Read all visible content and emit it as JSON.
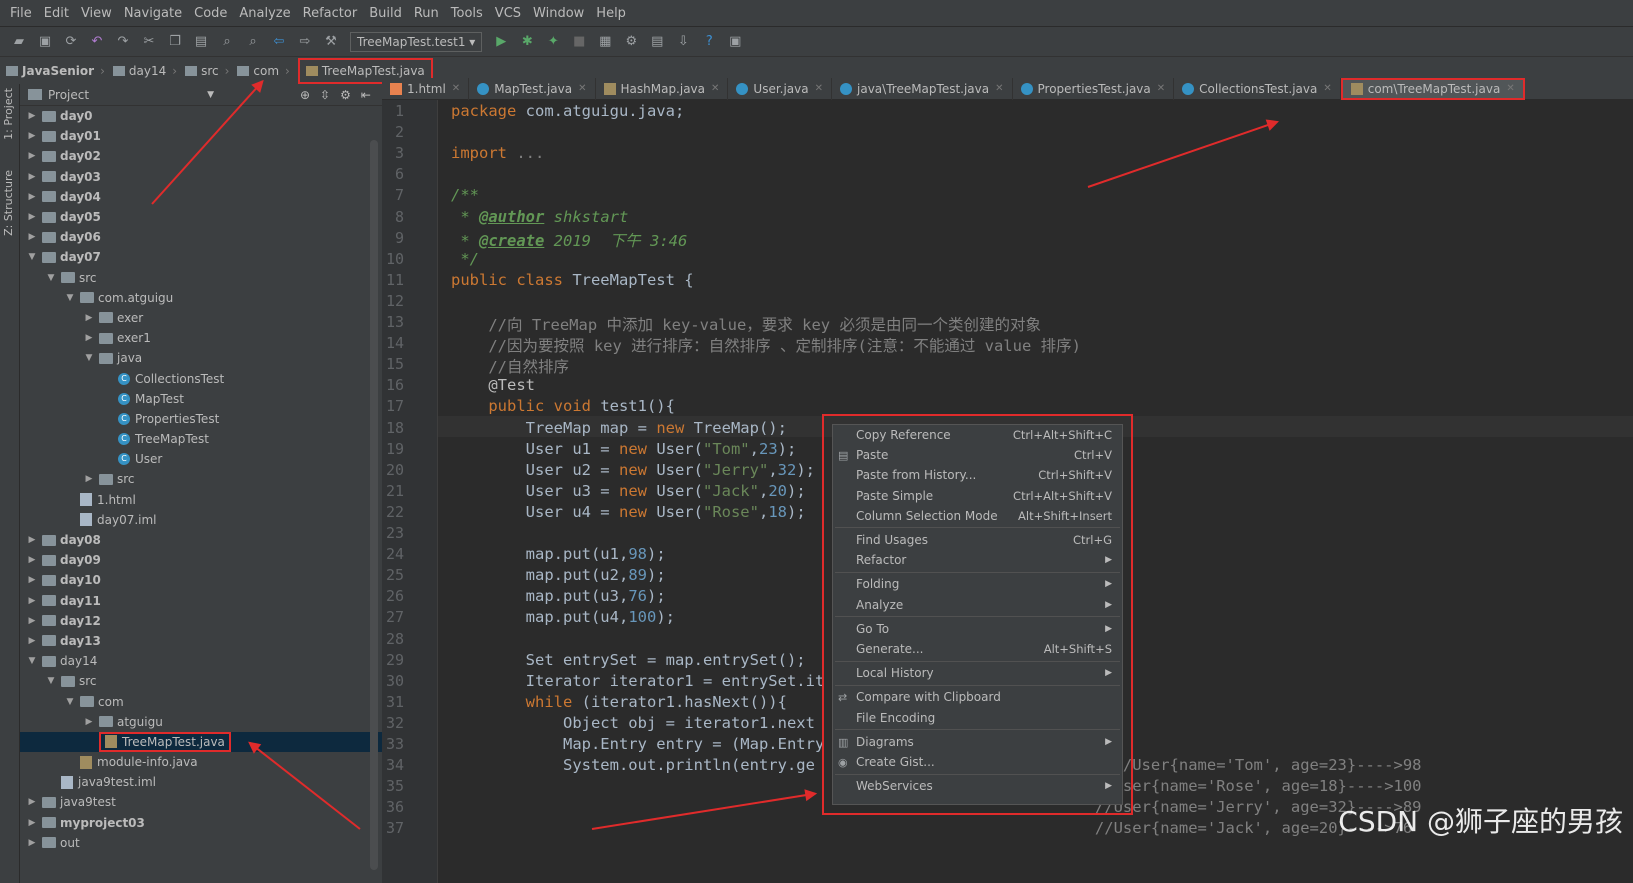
{
  "menu": [
    "File",
    "Edit",
    "View",
    "Navigate",
    "Code",
    "Analyze",
    "Refactor",
    "Build",
    "Run",
    "Tools",
    "VCS",
    "Window",
    "Help"
  ],
  "toolbar": {
    "run_config": "TreeMapTest.test1"
  },
  "breadcrumb": [
    "JavaSenior",
    "day14",
    "src",
    "com",
    "TreeMapTest.java"
  ],
  "side_tabs": {
    "project": "1: Project",
    "structure": "Z: Structure"
  },
  "project_panel": {
    "title": "Project"
  },
  "tree": [
    {
      "label": "day0",
      "indent": 1,
      "arrow": "▶",
      "icon": "folder",
      "bold": true
    },
    {
      "label": "day01",
      "indent": 1,
      "arrow": "▶",
      "icon": "folder",
      "bold": true
    },
    {
      "label": "day02",
      "indent": 1,
      "arrow": "▶",
      "icon": "folder",
      "bold": true
    },
    {
      "label": "day03",
      "indent": 1,
      "arrow": "▶",
      "icon": "folder",
      "bold": true
    },
    {
      "label": "day04",
      "indent": 1,
      "arrow": "▶",
      "icon": "folder",
      "bold": true
    },
    {
      "label": "day05",
      "indent": 1,
      "arrow": "▶",
      "icon": "folder",
      "bold": true
    },
    {
      "label": "day06",
      "indent": 1,
      "arrow": "▶",
      "icon": "folder",
      "bold": true
    },
    {
      "label": "day07",
      "indent": 1,
      "arrow": "▼",
      "icon": "folder",
      "bold": true
    },
    {
      "label": "src",
      "indent": 2,
      "arrow": "▼",
      "icon": "folder"
    },
    {
      "label": "com.atguigu",
      "indent": 3,
      "arrow": "▼",
      "icon": "folder"
    },
    {
      "label": "exer",
      "indent": 4,
      "arrow": "▶",
      "icon": "folder"
    },
    {
      "label": "exer1",
      "indent": 4,
      "arrow": "▶",
      "icon": "folder"
    },
    {
      "label": "java",
      "indent": 4,
      "arrow": "▼",
      "icon": "folder"
    },
    {
      "label": "CollectionsTest",
      "indent": 5,
      "arrow": "",
      "icon": "class"
    },
    {
      "label": "MapTest",
      "indent": 5,
      "arrow": "",
      "icon": "class"
    },
    {
      "label": "PropertiesTest",
      "indent": 5,
      "arrow": "",
      "icon": "class"
    },
    {
      "label": "TreeMapTest",
      "indent": 5,
      "arrow": "",
      "icon": "class"
    },
    {
      "label": "User",
      "indent": 5,
      "arrow": "",
      "icon": "class"
    },
    {
      "label": "src",
      "indent": 4,
      "arrow": "▶",
      "icon": "folder"
    },
    {
      "label": "1.html",
      "indent": 3,
      "arrow": "",
      "icon": "html"
    },
    {
      "label": "day07.iml",
      "indent": 3,
      "arrow": "",
      "icon": "file"
    },
    {
      "label": "day08",
      "indent": 1,
      "arrow": "▶",
      "icon": "folder",
      "bold": true
    },
    {
      "label": "day09",
      "indent": 1,
      "arrow": "▶",
      "icon": "folder",
      "bold": true
    },
    {
      "label": "day10",
      "indent": 1,
      "arrow": "▶",
      "icon": "folder",
      "bold": true
    },
    {
      "label": "day11",
      "indent": 1,
      "arrow": "▶",
      "icon": "folder",
      "bold": true
    },
    {
      "label": "day12",
      "indent": 1,
      "arrow": "▶",
      "icon": "folder",
      "bold": true
    },
    {
      "label": "day13",
      "indent": 1,
      "arrow": "▶",
      "icon": "folder",
      "bold": true
    },
    {
      "label": "day14",
      "indent": 1,
      "arrow": "▼",
      "icon": "folder"
    },
    {
      "label": "src",
      "indent": 2,
      "arrow": "▼",
      "icon": "folder"
    },
    {
      "label": "com",
      "indent": 3,
      "arrow": "▼",
      "icon": "folder"
    },
    {
      "label": "atguigu",
      "indent": 4,
      "arrow": "▶",
      "icon": "folder"
    },
    {
      "label": "TreeMapTest.java",
      "indent": 4,
      "arrow": "",
      "icon": "java",
      "selected": true
    },
    {
      "label": "module-info.java",
      "indent": 3,
      "arrow": "",
      "icon": "java"
    },
    {
      "label": "java9test.iml",
      "indent": 2,
      "arrow": "",
      "icon": "file"
    },
    {
      "label": "java9test",
      "indent": 1,
      "arrow": "▶",
      "icon": "folder"
    },
    {
      "label": "myproject03",
      "indent": 1,
      "arrow": "▶",
      "icon": "folder",
      "bold": true
    },
    {
      "label": "out",
      "indent": 1,
      "arrow": "▶",
      "icon": "folder"
    }
  ],
  "tabs": [
    {
      "label": "1.html"
    },
    {
      "label": "MapTest.java"
    },
    {
      "label": "HashMap.java"
    },
    {
      "label": "User.java"
    },
    {
      "label": "java\\TreeMapTest.java"
    },
    {
      "label": "PropertiesTest.java"
    },
    {
      "label": "CollectionsTest.java"
    },
    {
      "label": "com\\TreeMapTest.java",
      "active": true
    }
  ],
  "line_numbers": [
    "1",
    "2",
    "3",
    "6",
    "7",
    "8",
    "9",
    "10",
    "11",
    "12",
    "13",
    "14",
    "15",
    "16",
    "17",
    "18",
    "19",
    "20",
    "21",
    "22",
    "23",
    "24",
    "25",
    "26",
    "27",
    "28",
    "29",
    "30",
    "31",
    "32",
    "33",
    "34",
    "35",
    "36",
    "37"
  ],
  "code_lines": [
    "<span class='kw'>package</span> com.atguigu.java;",
    "",
    "<span class='kw'>import</span> <span class='lc'>...</span>",
    "",
    "<span class='cm'>/**</span>",
    "<span class='cm'> * </span><span class='tag'>@author</span><span class='cm'> shkstart</span>",
    "<span class='cm'> * </span><span class='tag'>@create</span><span class='cm'> 2019  下午 3:46</span>",
    "<span class='cm'> */</span>",
    "<span class='kw'>public class</span> TreeMapTest {",
    "",
    "    <span class='lc'>//向 TreeMap 中添加 key-value，要求 key 必须是由同一个类创建的对象</span>",
    "    <span class='lc'>//因为要按照 key 进行排序：自然排序 、定制排序(注意：不能通过 value 排序)</span>",
    "    <span class='lc'>//自然排序</span>",
    "    <span class='an'>@Test</span>",
    "    <span class='kw'>public void</span> test1(){",
    "        TreeMap map = <span class='kw'>new</span> TreeMap();",
    "        User u1 = <span class='kw'>new</span> User(<span class='str'>\"Tom\"</span>,<span class='num'>23</span>);",
    "        User u2 = <span class='kw'>new</span> User(<span class='str'>\"Jerry\"</span>,<span class='num'>32</span>);",
    "        User u3 = <span class='kw'>new</span> User(<span class='str'>\"Jack\"</span>,<span class='num'>20</span>);",
    "        User u4 = <span class='kw'>new</span> User(<span class='str'>\"Rose\"</span>,<span class='num'>18</span>);",
    "",
    "        map.put(u1,<span class='num'>98</span>);",
    "        map.put(u2,<span class='num'>89</span>);",
    "        map.put(u3,<span class='num'>76</span>);",
    "        map.put(u4,<span class='num'>100</span>);",
    "",
    "        Set entrySet = map.entrySet();",
    "        Iterator iterator1 = entrySet.it",
    "        <span class='kw'>while</span> (iterator1.hasNext()){",
    "            Object obj = iterator1.next",
    "            Map.Entry entry = (Map.Entry",
    "            System.out.println(entry.ge                          ue());<span class='lc'>//User{name='Tom', age=23}---->98</span>",
    "                                                                     <span class='lc'>//User{name='Rose', age=18}---->100</span>",
    "                                                                     <span class='lc'>//User{name='Jerry', age=32}---->89</span>",
    "                                                                     <span class='lc'>//User{name='Jack', age=20}---->76</span>"
  ],
  "context_menu": [
    {
      "label": "Copy Reference",
      "shortcut": "Ctrl+Alt+Shift+C"
    },
    {
      "label": "Paste",
      "shortcut": "Ctrl+V",
      "icon": "paste-icon"
    },
    {
      "label": "Paste from History...",
      "shortcut": "Ctrl+Shift+V"
    },
    {
      "label": "Paste Simple",
      "shortcut": "Ctrl+Alt+Shift+V"
    },
    {
      "label": "Column Selection Mode",
      "shortcut": "Alt+Shift+Insert"
    },
    {
      "sep": true
    },
    {
      "label": "Find Usages",
      "shortcut": "Ctrl+G"
    },
    {
      "label": "Refactor",
      "submenu": true
    },
    {
      "sep": true
    },
    {
      "label": "Folding",
      "submenu": true
    },
    {
      "label": "Analyze",
      "submenu": true
    },
    {
      "sep": true
    },
    {
      "label": "Go To",
      "submenu": true
    },
    {
      "label": "Generate...",
      "shortcut": "Alt+Shift+S"
    },
    {
      "sep": true
    },
    {
      "label": "Local History",
      "submenu": true
    },
    {
      "sep": true
    },
    {
      "label": "Compare with Clipboard",
      "icon": "compare-icon"
    },
    {
      "label": "File Encoding"
    },
    {
      "sep": true
    },
    {
      "label": "Diagrams",
      "submenu": true,
      "icon": "diagram-icon"
    },
    {
      "label": "Create Gist...",
      "icon": "github-icon"
    },
    {
      "sep": true
    },
    {
      "label": "WebServices",
      "submenu": true
    }
  ],
  "watermark": "CSDN @狮子座的男孩",
  "colors": {
    "annotation_red": "#e02b2b",
    "editor_bg": "#2b2b2b",
    "panel_bg": "#3c3f41",
    "keyword": "#cc7832",
    "string": "#6a8759"
  }
}
